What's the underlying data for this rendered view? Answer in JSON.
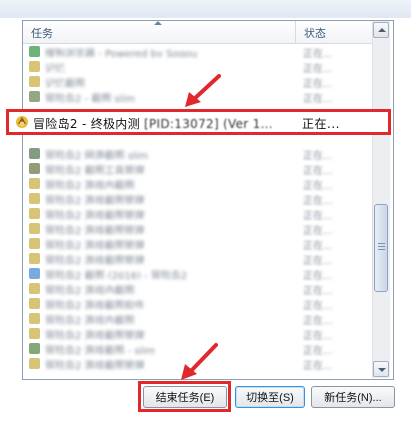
{
  "header": {
    "task_col": "任务",
    "status_col": "状态"
  },
  "main_row": {
    "name": "冒险岛2 - 终极内测",
    "name_tail": "[PID:13072] (Ver 1...",
    "status": "正在..."
  },
  "rows": [
    {
      "name": "搜狗浏览器 - Powered by Sogou",
      "status": "正在..."
    },
    {
      "name": "记忆",
      "status": "正在..."
    },
    {
      "name": "记忆截图",
      "status": "正在..."
    },
    {
      "name": "冒险岛2 - 截图 slim",
      "status": "正在..."
    },
    {
      "name": "冒险岛2 网游截图 slim",
      "status": "正在..."
    },
    {
      "name": "冒险岛2 截图工具管理",
      "status": "正在..."
    },
    {
      "name": "冒险岛2 游戏内截图",
      "status": "正在..."
    },
    {
      "name": "冒险岛2 游戏截图管理",
      "status": "正在..."
    },
    {
      "name": "冒险岛2 游戏截图管理",
      "status": "正在..."
    },
    {
      "name": "冒险岛2 游戏截图管理",
      "status": "正在..."
    },
    {
      "name": "冒险岛2 游戏截图管理",
      "status": "正在..."
    },
    {
      "name": "冒险岛2 游戏截图管理",
      "status": "正在..."
    },
    {
      "name": "冒险岛2 截图 (2016) - 冒险岛2",
      "status": "正在..."
    },
    {
      "name": "冒险岛2 游戏内截图",
      "status": "正在..."
    },
    {
      "name": "冒险岛2 游戏截图软件",
      "status": "正在..."
    },
    {
      "name": "冒险岛2 游戏内截图",
      "status": "正在..."
    },
    {
      "name": "冒险岛2 游戏截图管理",
      "status": "正在..."
    },
    {
      "name": "冒险岛2 游戏截图 - slim",
      "status": "正在..."
    },
    {
      "name": "冒险岛2 游戏截图管理",
      "status": "正在..."
    }
  ],
  "buttons": {
    "end_task": "结束任务(E)",
    "switch_to": "切换至(S)",
    "new_task": "新任务(N)..."
  },
  "colors": {
    "highlight": "#e0282d",
    "focus_button": "#3e8edb"
  }
}
